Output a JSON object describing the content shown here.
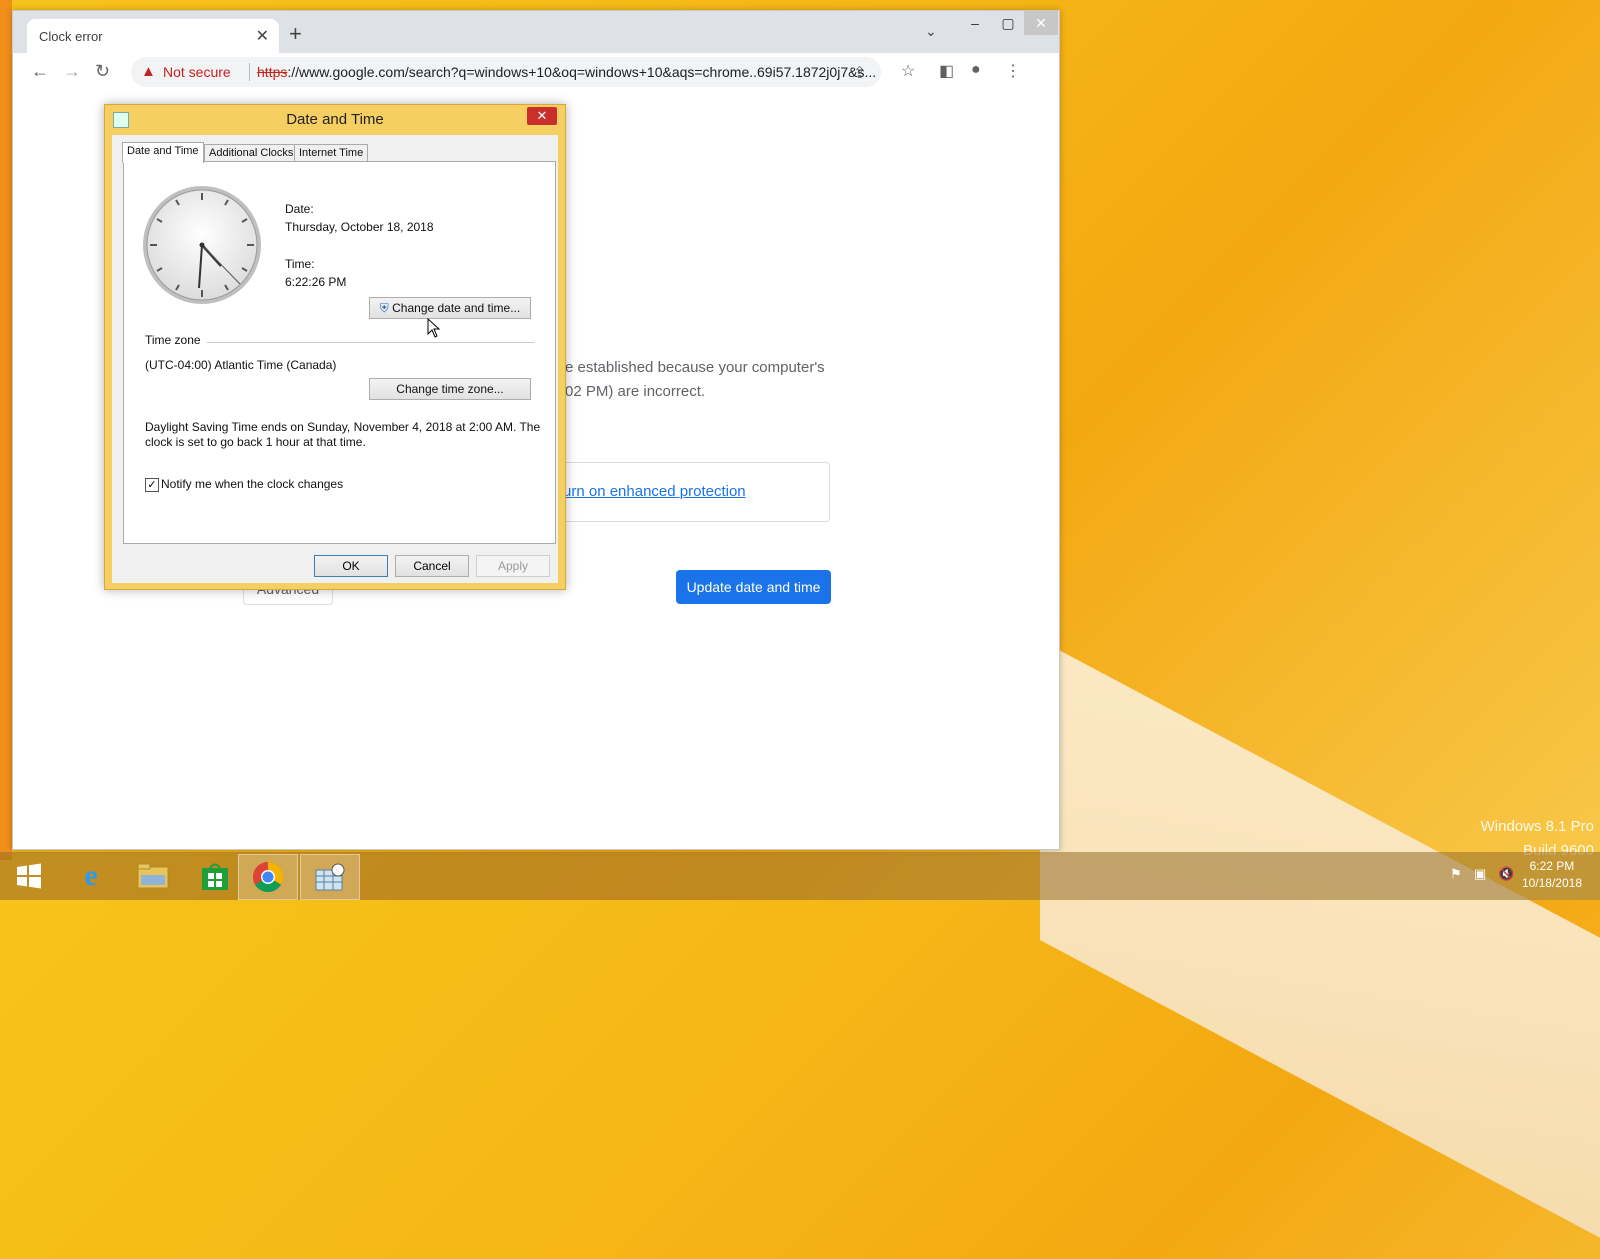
{
  "desktop": {
    "edition": "Windows 8.1 Pro",
    "build": "Build 9600"
  },
  "browser": {
    "tab_title": "Clock error",
    "tab_close": "✕",
    "new_tab": "+",
    "tab_search": "⌄",
    "window_controls": {
      "minimize": "–",
      "maximize": "▢",
      "close": "✕"
    },
    "nav": {
      "back": "←",
      "forward": "→",
      "reload": "↻"
    },
    "security_label": "Not secure",
    "url_scheme": "https",
    "url_rest": "://www.google.com/search?q=windows+10&oq=windows+10&aqs=chrome..69i57.1872j0j7&s..."
  },
  "page": {
    "error_line1": "e established because your computer's",
    "error_line2": "02 PM) are incorrect.",
    "protection_link": "urn on enhanced protection",
    "advanced_button": "Advanced",
    "update_button": "Update date and time"
  },
  "dialog": {
    "title": "Date and Time",
    "close": "✕",
    "tabs": [
      "Date and Time",
      "Additional Clocks",
      "Internet Time"
    ],
    "date_label": "Date:",
    "date_value": "Thursday, October 18, 2018",
    "time_label": "Time:",
    "time_value": "6:22:26 PM",
    "change_datetime_button": "Change date and time...",
    "timezone_heading": "Time zone",
    "timezone_value": "(UTC-04:00) Atlantic Time (Canada)",
    "change_timezone_button": "Change time zone...",
    "dst_line1": "Daylight Saving Time ends on Sunday, November 4, 2018 at 2:00 AM. The",
    "dst_line2": "clock is set to go back 1 hour at that time.",
    "notify_checkbox_label": "Notify me when the clock changes",
    "notify_checked": true,
    "ok": "OK",
    "cancel": "Cancel",
    "apply": "Apply"
  },
  "taskbar": {
    "time": "6:22 PM",
    "date": "10/18/2018"
  }
}
